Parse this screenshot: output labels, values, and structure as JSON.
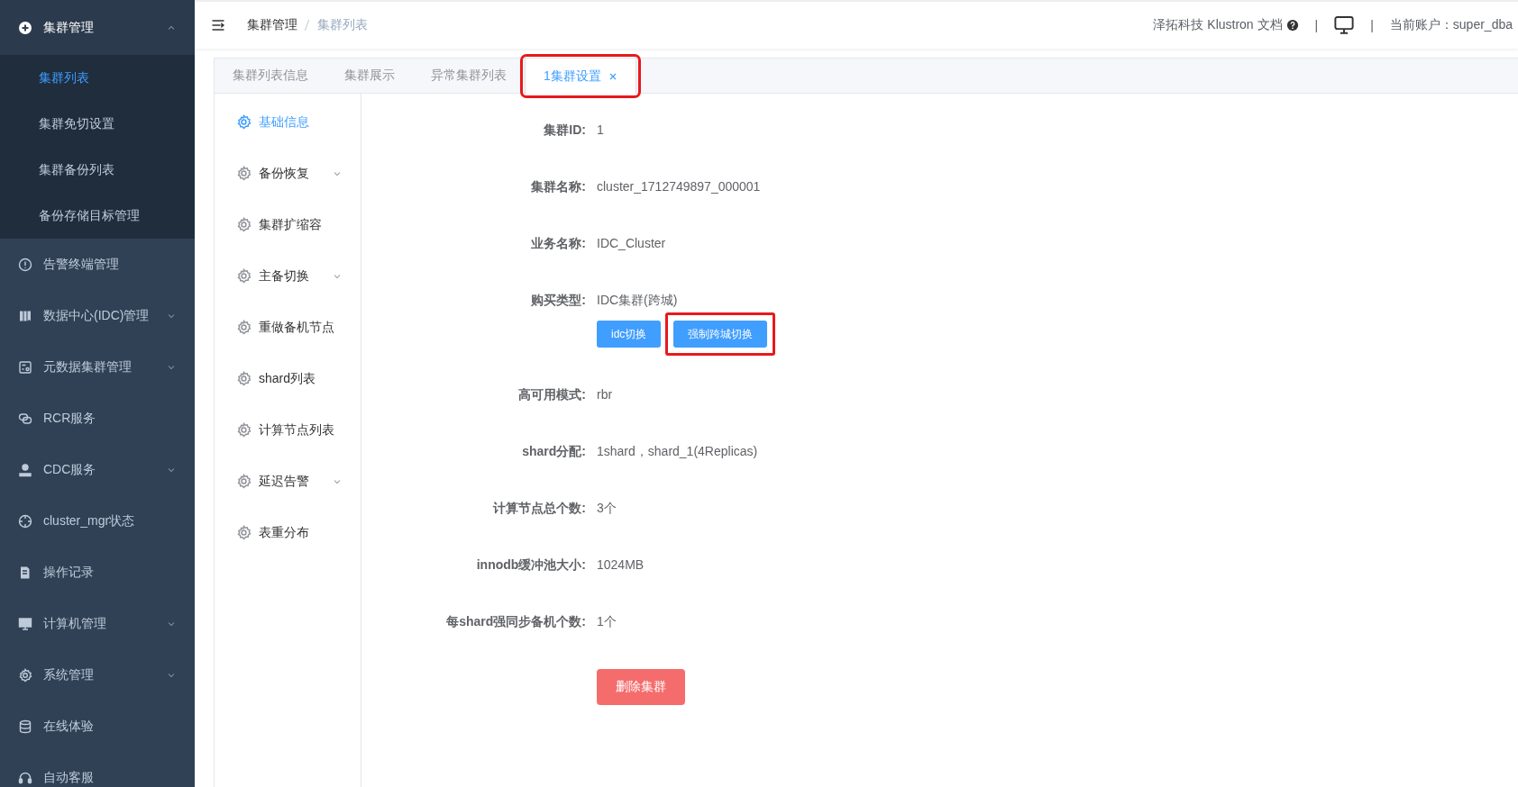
{
  "sidebar": {
    "group": {
      "label": "集群管理",
      "expanded": true,
      "children": [
        {
          "label": "集群列表",
          "selected": true
        },
        {
          "label": "集群免切设置",
          "selected": false
        },
        {
          "label": "集群备份列表",
          "selected": false
        },
        {
          "label": "备份存储目标管理",
          "selected": false
        }
      ]
    },
    "items": [
      {
        "label": "告警终端管理",
        "expandable": false
      },
      {
        "label": "数据中心(IDC)管理",
        "expandable": true
      },
      {
        "label": "元数据集群管理",
        "expandable": true
      },
      {
        "label": "RCR服务",
        "expandable": false
      },
      {
        "label": "CDC服务",
        "expandable": true
      },
      {
        "label": "cluster_mgr状态",
        "expandable": false
      },
      {
        "label": "操作记录",
        "expandable": false
      },
      {
        "label": "计算机管理",
        "expandable": true
      },
      {
        "label": "系统管理",
        "expandable": true
      },
      {
        "label": "在线体验",
        "expandable": false
      },
      {
        "label": "自动客服",
        "expandable": false
      }
    ]
  },
  "header": {
    "breadcrumb": [
      "集群管理",
      "集群列表"
    ],
    "docs_link": "泽拓科技 Klustron 文档",
    "separators": [
      "|",
      "|"
    ],
    "account": "当前账户：super_dba"
  },
  "tabs": [
    {
      "label": "集群列表信息",
      "selected": false,
      "closable": false,
      "highlighted": false
    },
    {
      "label": "集群展示",
      "selected": false,
      "closable": false,
      "highlighted": false
    },
    {
      "label": "异常集群列表",
      "selected": false,
      "closable": false,
      "highlighted": false
    },
    {
      "label": "1集群设置",
      "selected": true,
      "closable": true,
      "highlighted": true
    }
  ],
  "settings_menu": [
    {
      "label": "基础信息",
      "selected": true,
      "expandable": false
    },
    {
      "label": "备份恢复",
      "selected": false,
      "expandable": true
    },
    {
      "label": "集群扩缩容",
      "selected": false,
      "expandable": false
    },
    {
      "label": "主备切换",
      "selected": false,
      "expandable": true
    },
    {
      "label": "重做备机节点",
      "selected": false,
      "expandable": false
    },
    {
      "label": "shard列表",
      "selected": false,
      "expandable": false
    },
    {
      "label": "计算节点列表",
      "selected": false,
      "expandable": false
    },
    {
      "label": "延迟告警",
      "selected": false,
      "expandable": true
    },
    {
      "label": "表重分布",
      "selected": false,
      "expandable": false
    }
  ],
  "fields": [
    {
      "label": "集群ID:",
      "value": "1"
    },
    {
      "label": "集群名称:",
      "value": "cluster_1712749897_000001"
    },
    {
      "label": "业务名称:",
      "value": "IDC_Cluster"
    },
    {
      "label": "购买类型:",
      "value": "IDC集群(跨城)",
      "buttons": [
        {
          "label": "idc切换",
          "highlighted": false
        },
        {
          "label": "强制跨城切换",
          "highlighted": true
        }
      ]
    },
    {
      "label": "高可用模式:",
      "value": "rbr"
    },
    {
      "label": "shard分配:",
      "value": "1shard，shard_1(4Replicas)"
    },
    {
      "label": "计算节点总个数:",
      "value": "3个"
    },
    {
      "label": "innodb缓冲池大小:",
      "value": "1024MB"
    },
    {
      "label": "每shard强同步备机个数:",
      "value": "1个"
    }
  ],
  "delete_button": "删除集群"
}
